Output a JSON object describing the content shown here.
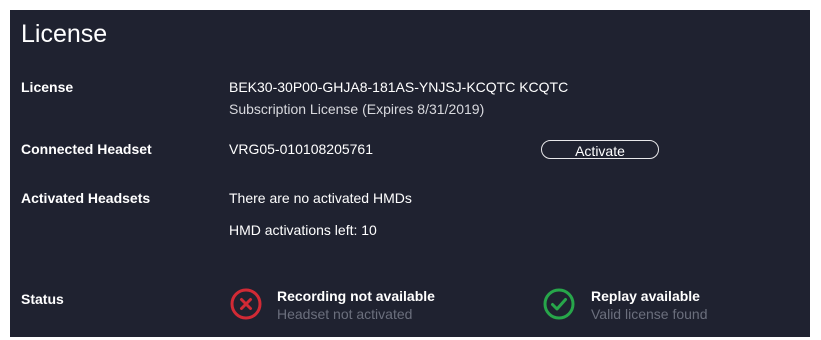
{
  "title": "License",
  "rows": {
    "license": {
      "label": "License",
      "key": "BEK30-30P00-GHJA8-181AS-YNJSJ-KCQTC KCQTC",
      "subscription": "Subscription License (Expires 8/31/2019)"
    },
    "headset": {
      "label": "Connected Headset",
      "serial": "VRG05-010108205761",
      "activate_label": "Activate"
    },
    "activated": {
      "label": "Activated Headsets",
      "none_text": "There are no activated HMDs",
      "activations_left": "HMD activations left: 10"
    },
    "status": {
      "label": "Status",
      "recording": {
        "title": "Recording not available",
        "detail": "Headset not activated",
        "icon": "error-x-icon",
        "color": "#d12a35"
      },
      "replay": {
        "title": "Replay available",
        "detail": "Valid license found",
        "icon": "check-icon",
        "color": "#27a64a"
      }
    }
  },
  "colors": {
    "panel_bg": "#1f2230",
    "muted_text": "#6b6f7d"
  }
}
